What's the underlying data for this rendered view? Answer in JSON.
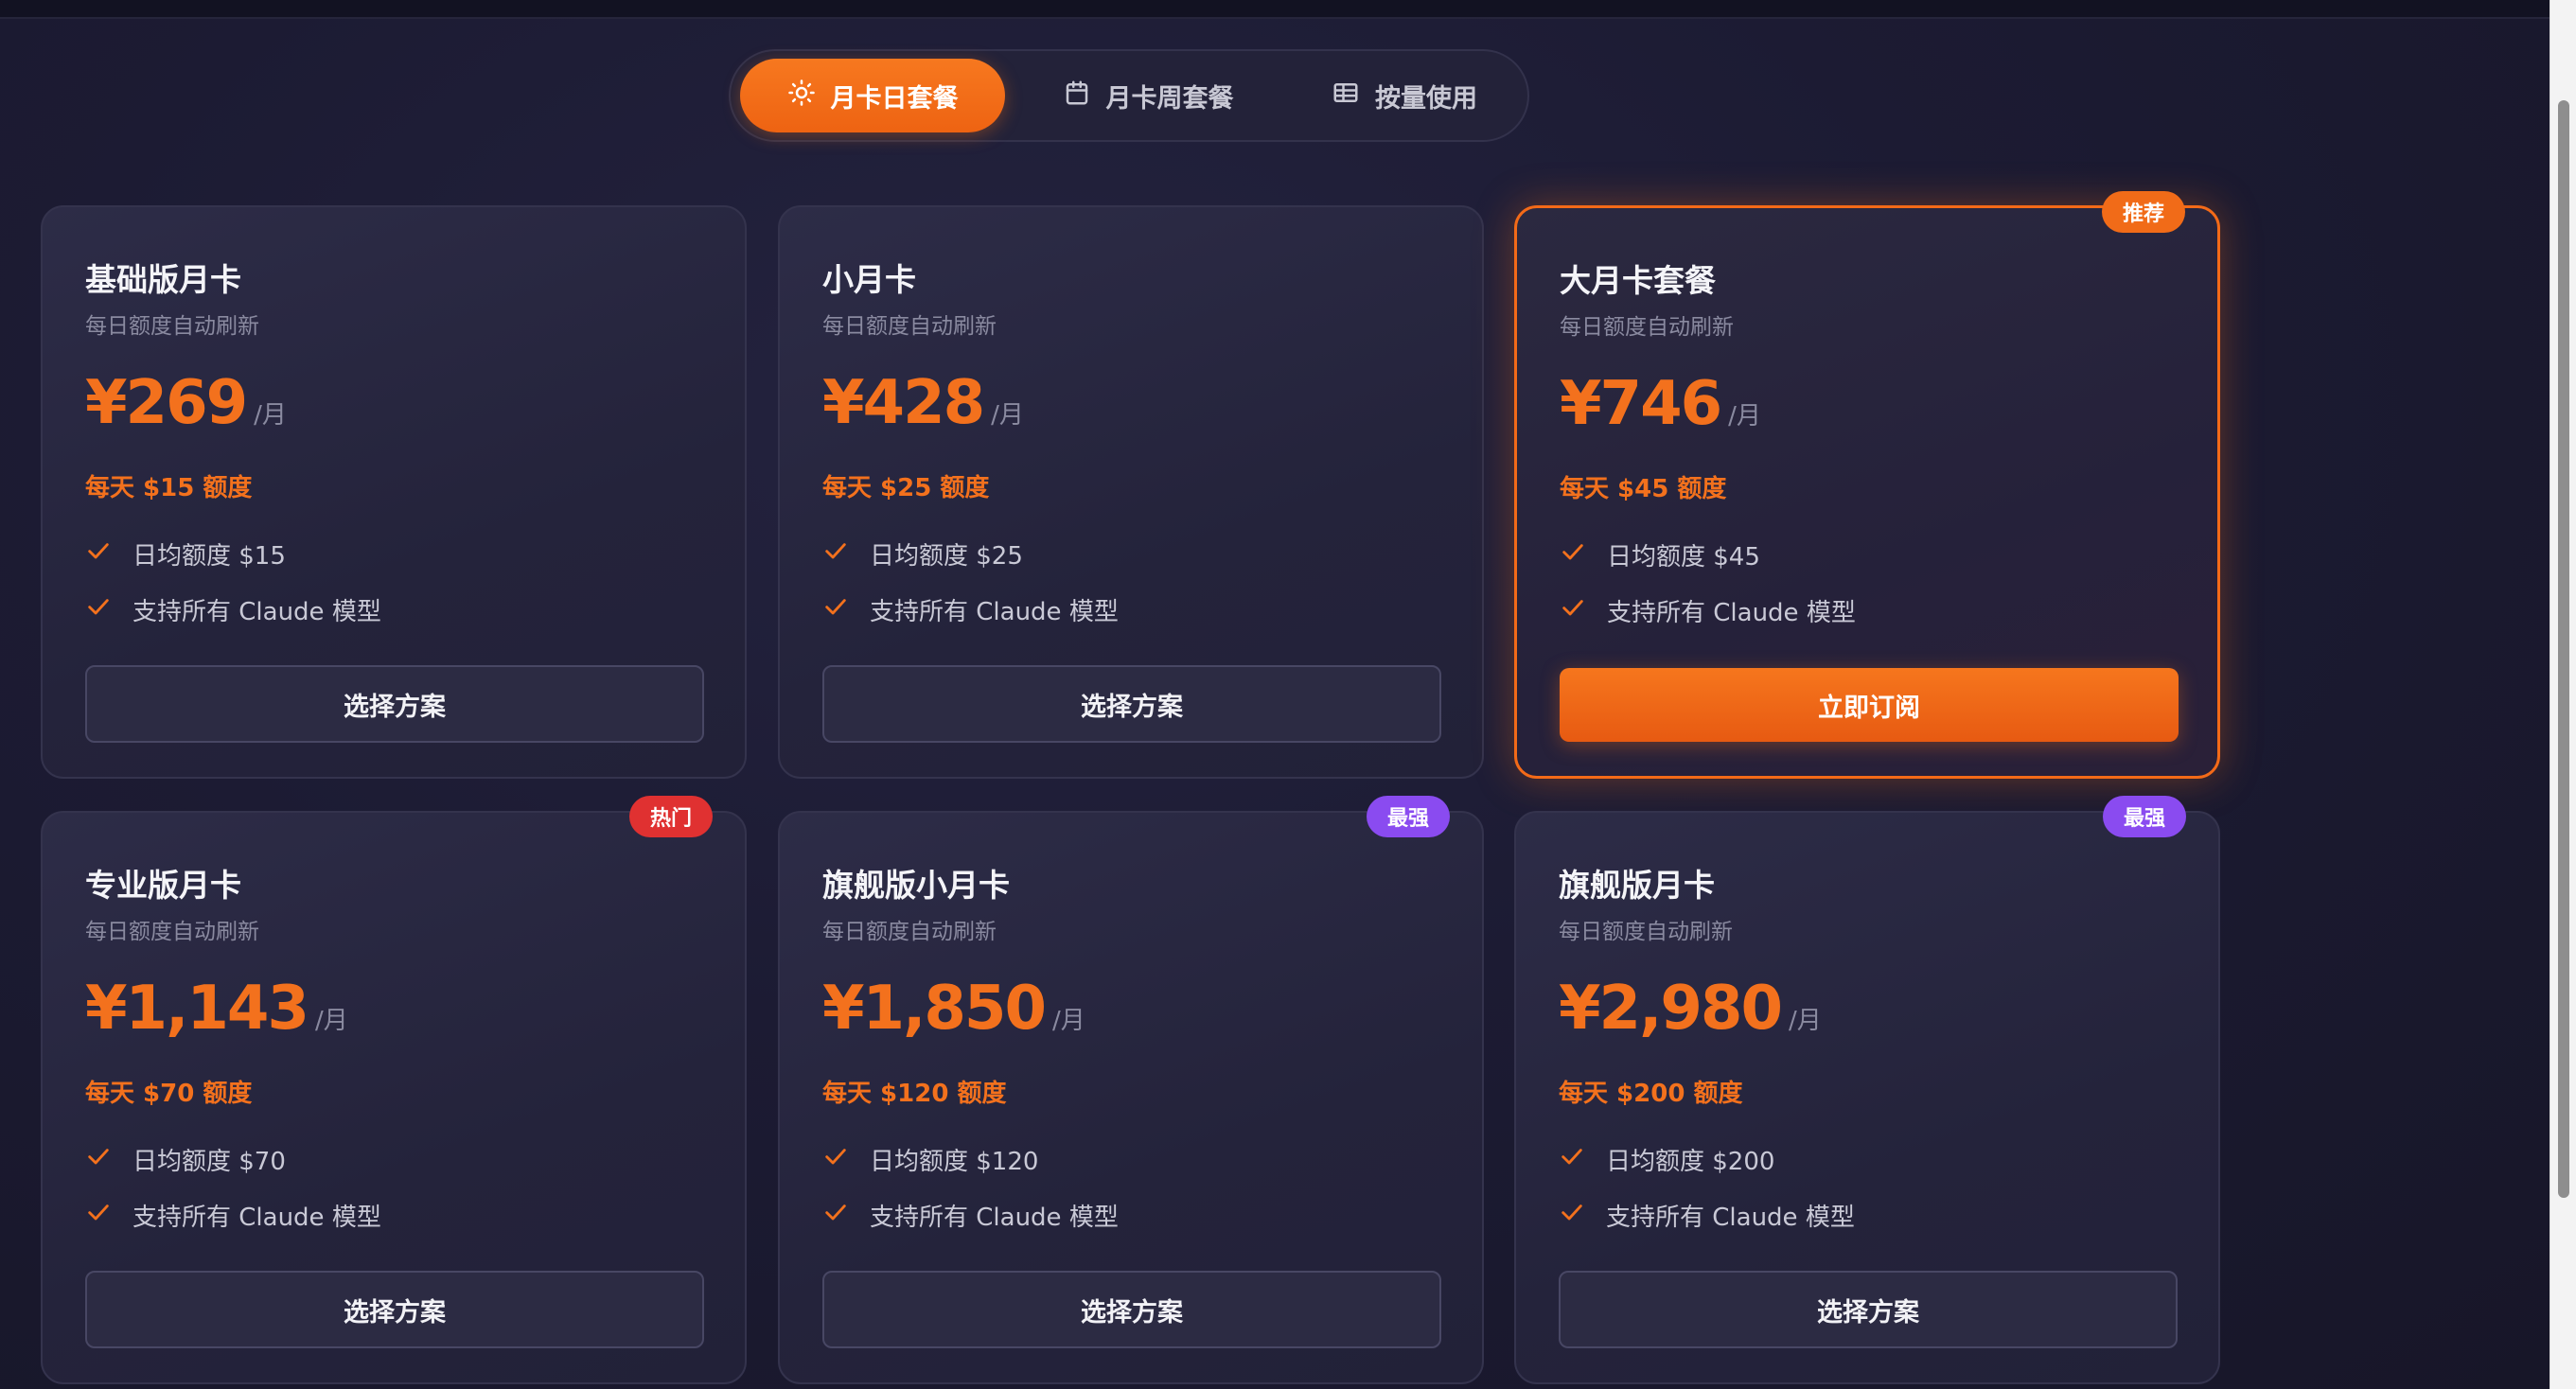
{
  "tabs": [
    {
      "label": "月卡日套餐",
      "icon": "sun-icon",
      "active": true
    },
    {
      "label": "月卡周套餐",
      "icon": "calendar-icon",
      "active": false
    },
    {
      "label": "按量使用",
      "icon": "table-icon",
      "active": false
    }
  ],
  "colors": {
    "accent": "#f3711d",
    "badge_red": "#e03131",
    "badge_purple": "#8a4bf0"
  },
  "plans": [
    {
      "title": "基础版月卡",
      "subtitle": "每日额度自动刷新",
      "price": "¥269",
      "period": "/月",
      "quota": "每天 $15 额度",
      "features": [
        "日均额度 $15",
        "支持所有 Claude 模型"
      ],
      "button": "选择方案",
      "badge": ""
    },
    {
      "title": "小月卡",
      "subtitle": "每日额度自动刷新",
      "price": "¥428",
      "period": "/月",
      "quota": "每天 $25 额度",
      "features": [
        "日均额度 $25",
        "支持所有 Claude 模型"
      ],
      "button": "选择方案",
      "badge": ""
    },
    {
      "title": "大月卡套餐",
      "subtitle": "每日额度自动刷新",
      "price": "¥746",
      "period": "/月",
      "quota": "每天 $45 额度",
      "features": [
        "日均额度 $45",
        "支持所有 Claude 模型"
      ],
      "button": "立即订阅",
      "badge": "推荐"
    },
    {
      "title": "专业版月卡",
      "subtitle": "每日额度自动刷新",
      "price": "¥1,143",
      "period": "/月",
      "quota": "每天 $70 额度",
      "features": [
        "日均额度 $70",
        "支持所有 Claude 模型"
      ],
      "button": "选择方案",
      "badge": "热门"
    },
    {
      "title": "旗舰版小月卡",
      "subtitle": "每日额度自动刷新",
      "price": "¥1,850",
      "period": "/月",
      "quota": "每天 $120 额度",
      "features": [
        "日均额度 $120",
        "支持所有 Claude 模型"
      ],
      "button": "选择方案",
      "badge": "最强"
    },
    {
      "title": "旗舰版月卡",
      "subtitle": "每日额度自动刷新",
      "price": "¥2,980",
      "period": "/月",
      "quota": "每天 $200 额度",
      "features": [
        "日均额度 $200",
        "支持所有 Claude 模型"
      ],
      "button": "选择方案",
      "badge": "最强"
    }
  ]
}
